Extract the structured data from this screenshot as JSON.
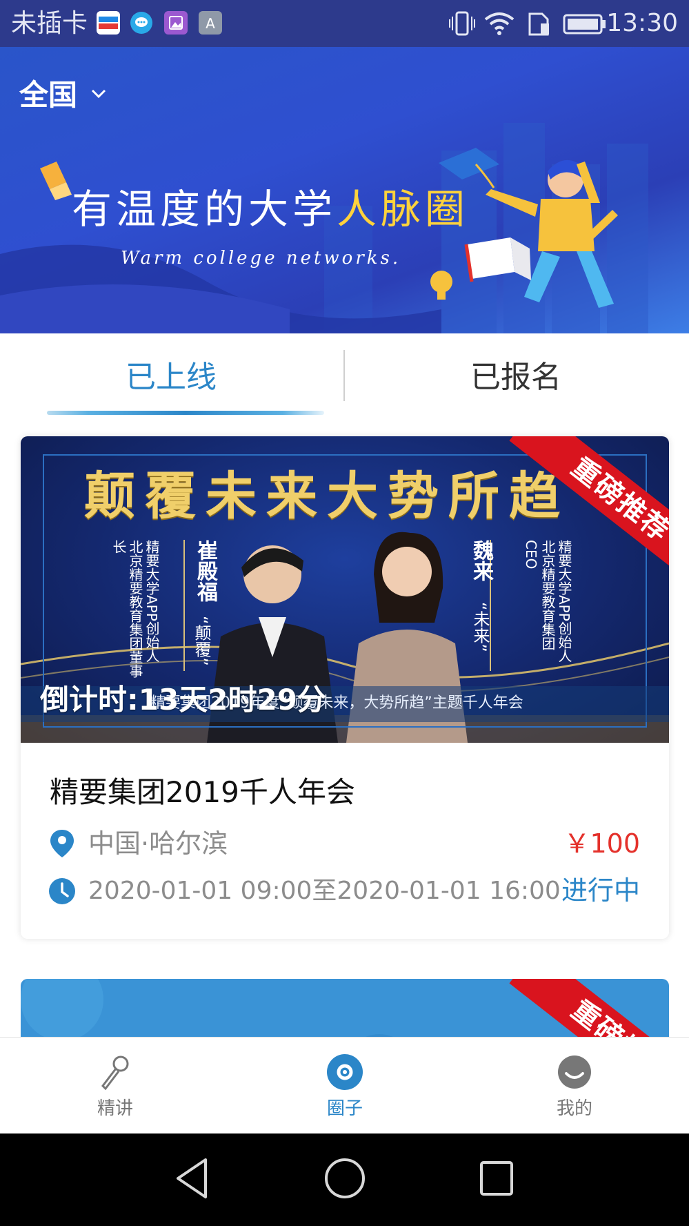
{
  "statusbar": {
    "carrier": "未插卡",
    "time": "13:30",
    "app_icons": [
      "youku-icon",
      "message-icon",
      "gallery-icon",
      "font-icon"
    ]
  },
  "banner": {
    "region": "全国",
    "title_main": "有温度的大学",
    "title_highlight": "人脉圈",
    "subtitle": "Warm college networks."
  },
  "tabs": [
    {
      "label": "已上线",
      "active": true
    },
    {
      "label": "已报名",
      "active": false
    }
  ],
  "events": [
    {
      "poster": {
        "headline": "颠覆未来大势所趋",
        "ribbon": "重磅推荐",
        "speaker_left_name": "崔殿福",
        "speaker_left_quote": "“颠覆”",
        "speaker_left_title": "精要大学APP创始人 北京精要教育集团董事长",
        "speaker_right_name": "魏来",
        "speaker_right_quote": "“未来”",
        "speaker_right_title": "精要大学APP创始人 北京精要教育集团CEO",
        "caption": "精要集团2019年度“颠覆未来，大势所趋”主题千人年会",
        "countdown": "倒计时:13天2时29分"
      },
      "title": "精要集团2019千人年会",
      "location": "中国·哈尔滨",
      "price": "￥100",
      "time": "2020-01-01 09:00至2020-01-01 16:00",
      "status": "进行中"
    },
    {
      "poster": {
        "ribbon": "重磅推荐"
      }
    }
  ],
  "bottom_nav": [
    {
      "label": "精讲",
      "icon": "microphone-icon",
      "active": false
    },
    {
      "label": "圈子",
      "icon": "circle-icon",
      "active": true
    },
    {
      "label": "我的",
      "icon": "profile-icon",
      "active": false
    }
  ],
  "colors": {
    "accent": "#2b86c8",
    "price": "#e4312b",
    "ribbon": "#d9141e",
    "banner": "#2f4fd0",
    "statusbar": "#2d3a8c"
  }
}
